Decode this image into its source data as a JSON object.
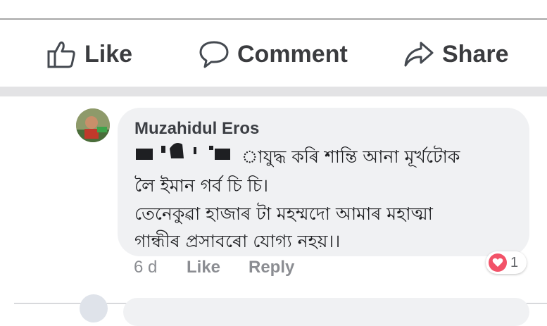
{
  "actions": {
    "like_label": "Like",
    "comment_label": "Comment",
    "share_label": "Share"
  },
  "comment": {
    "author": "Muzahidul Eros",
    "lines": [
      "াযুদ্ধ কৰি শান্তি আনা মূৰ্খটোক",
      "লৈ ইমান গৰ্ব চি চি।",
      "তেনেকুৱা হাজাৰ টা মহম্মদো আমাৰ মহাত্মা",
      "গান্ধীৰ প্ৰসাবৰো যোগ্য নহয়।।"
    ],
    "time": "6 d",
    "like_label": "Like",
    "reply_label": "Reply",
    "reaction": {
      "type": "heart-icon",
      "count": "1",
      "color": "#f25268"
    }
  },
  "colors": {
    "text_dark": "#3b3c3f",
    "meta_gray": "#8b8d92",
    "bubble_bg": "#f0f1f3"
  }
}
